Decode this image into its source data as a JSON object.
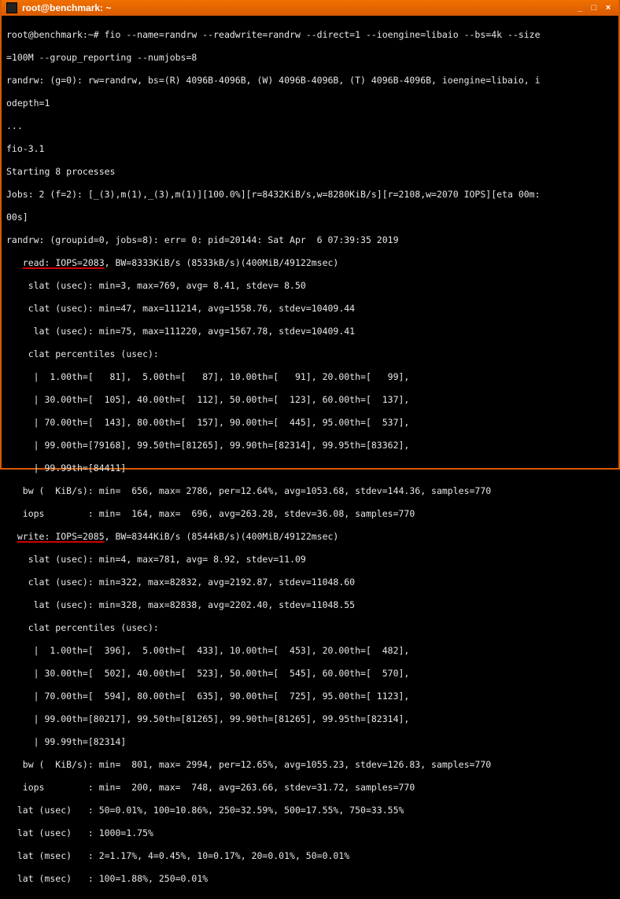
{
  "titlebar": {
    "title": "root@benchmark: ~",
    "min": "_",
    "max": "□",
    "close": "×"
  },
  "lines": {
    "l0": "root@benchmark:~# fio --name=randrw --readwrite=randrw --direct=1 --ioengine=libaio --bs=4k --size",
    "l1": "=100M --group_reporting --numjobs=8",
    "l2": "randrw: (g=0): rw=randrw, bs=(R) 4096B-4096B, (W) 4096B-4096B, (T) 4096B-4096B, ioengine=libaio, i",
    "l3": "odepth=1",
    "l4": "...",
    "l5": "fio-3.1",
    "l6": "Starting 8 processes",
    "l7": "Jobs: 2 (f=2): [_(3),m(1),_(3),m(1)][100.0%][r=8432KiB/s,w=8280KiB/s][r=2108,w=2070 IOPS][eta 00m:",
    "l8": "00s]",
    "l9": "randrw: (groupid=0, jobs=8): err= 0: pid=20144: Sat Apr  6 07:39:35 2019",
    "l10_pre": "   ",
    "l10_u": "read: IOPS=2083",
    "l10_post": ", BW=8333KiB/s (8533kB/s)(400MiB/49122msec)",
    "l11": "    slat (usec): min=3, max=769, avg= 8.41, stdev= 8.50",
    "l12": "    clat (usec): min=47, max=111214, avg=1558.76, stdev=10409.44",
    "l13": "     lat (usec): min=75, max=111220, avg=1567.78, stdev=10409.41",
    "l14": "    clat percentiles (usec):",
    "l15": "     |  1.00th=[   81],  5.00th=[   87], 10.00th=[   91], 20.00th=[   99],",
    "l16": "     | 30.00th=[  105], 40.00th=[  112], 50.00th=[  123], 60.00th=[  137],",
    "l17": "     | 70.00th=[  143], 80.00th=[  157], 90.00th=[  445], 95.00th=[  537],",
    "l18": "     | 99.00th=[79168], 99.50th=[81265], 99.90th=[82314], 99.95th=[83362],",
    "l19": "     | 99.99th=[84411]",
    "l20": "   bw (  KiB/s): min=  656, max= 2786, per=12.64%, avg=1053.68, stdev=144.36, samples=770",
    "l21": "   iops        : min=  164, max=  696, avg=263.28, stdev=36.08, samples=770",
    "l22_pre": "  ",
    "l22_u": "write: IOPS=2085",
    "l22_post": ", BW=8344KiB/s (8544kB/s)(400MiB/49122msec)",
    "l23": "    slat (usec): min=4, max=781, avg= 8.92, stdev=11.09",
    "l24": "    clat (usec): min=322, max=82832, avg=2192.87, stdev=11048.60",
    "l25": "     lat (usec): min=328, max=82838, avg=2202.40, stdev=11048.55",
    "l26": "    clat percentiles (usec):",
    "l27": "     |  1.00th=[  396],  5.00th=[  433], 10.00th=[  453], 20.00th=[  482],",
    "l28": "     | 30.00th=[  502], 40.00th=[  523], 50.00th=[  545], 60.00th=[  570],",
    "l29": "     | 70.00th=[  594], 80.00th=[  635], 90.00th=[  725], 95.00th=[ 1123],",
    "l30": "     | 99.00th=[80217], 99.50th=[81265], 99.90th=[81265], 99.95th=[82314],",
    "l31": "     | 99.99th=[82314]",
    "l32": "   bw (  KiB/s): min=  801, max= 2994, per=12.65%, avg=1055.23, stdev=126.83, samples=770",
    "l33": "   iops        : min=  200, max=  748, avg=263.66, stdev=31.72, samples=770",
    "l34": "  lat (usec)   : 50=0.01%, 100=10.86%, 250=32.59%, 500=17.55%, 750=33.55%",
    "l35": "  lat (usec)   : 1000=1.75%",
    "l36": "  lat (msec)   : 2=1.17%, 4=0.45%, 10=0.17%, 20=0.01%, 50=0.01%",
    "l37": "  lat (msec)   : 100=1.88%, 250=0.01%"
  }
}
